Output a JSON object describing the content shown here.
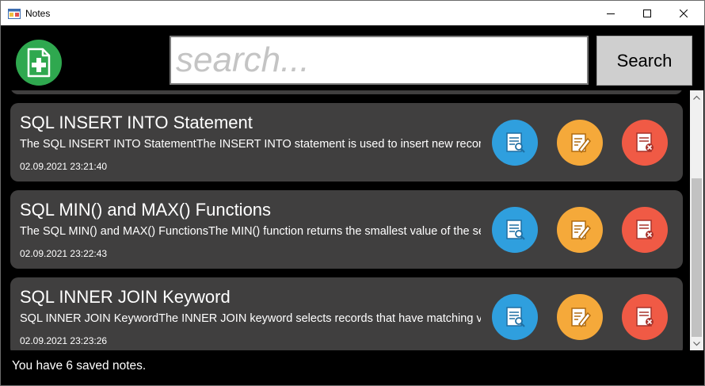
{
  "window": {
    "title": "Notes",
    "minimize_icon": "minimize-icon",
    "maximize_icon": "maximize-icon",
    "close_icon": "close-icon"
  },
  "toolbar": {
    "add_icon": "add-note-icon",
    "search_placeholder": "search...",
    "search_value": "",
    "search_label": "Search"
  },
  "notes": [
    {
      "title": "SQL INSERT INTO Statement",
      "preview": "The SQL INSERT INTO StatementThe INSERT INTO statement is used to insert new records in a table.",
      "date": "02.09.2021 23:21:40"
    },
    {
      "title": "SQL MIN() and MAX() Functions",
      "preview": "The SQL MIN() and MAX() FunctionsThe MIN() function returns the smallest value of the selected column.",
      "date": "02.09.2021 23:22:43"
    },
    {
      "title": "SQL INNER JOIN Keyword",
      "preview": "SQL INNER JOIN KeywordThe INNER JOIN keyword selects records that have matching values in both tables.",
      "date": "02.09.2021 23:23:26"
    }
  ],
  "actions": {
    "view_icon": "view-note-icon",
    "edit_icon": "edit-note-icon",
    "delete_icon": "delete-note-icon"
  },
  "colors": {
    "background": "#000000",
    "card": "#403f3f",
    "add": "#2fa84f",
    "view": "#2f9fde",
    "edit": "#f5a93a",
    "delete": "#f05a45"
  },
  "status": {
    "text": "You have 6 saved notes."
  }
}
